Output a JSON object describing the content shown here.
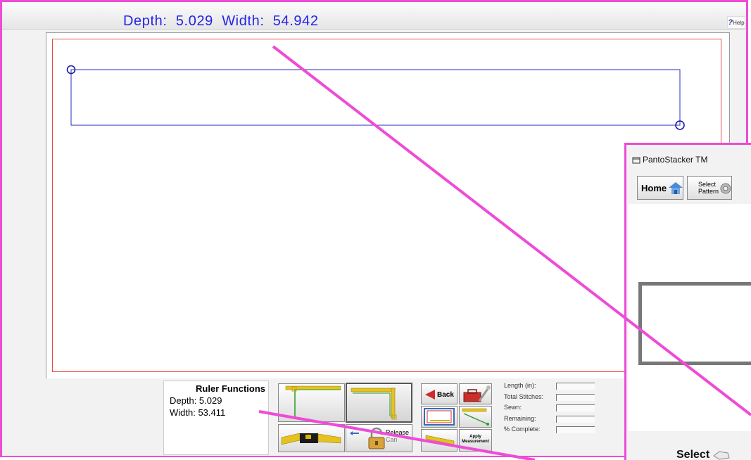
{
  "measurement_title": "Depth:  5.029  Width:  54.942",
  "help": {
    "label": "Help",
    "q": "?"
  },
  "ruler": {
    "title": "Ruler Functions",
    "depth_label": "Depth: 5.029",
    "width_label": "Width:  53.411"
  },
  "buttons": {
    "back_label": "Back",
    "release_label": "Release",
    "release_sub": "Can",
    "apply_label": "Apply",
    "apply_label2": "Measurement"
  },
  "stats": {
    "length_label": "Length (in):",
    "total_stitches_label": "Total Stitches:",
    "sewn_label": "Sewn:",
    "remaining_label": "Remaining:",
    "complete_label": "% Complete:"
  },
  "window2": {
    "title": "PantoStacker TM",
    "home_label": "Home",
    "select_pattern_line1": "Select",
    "select_pattern_line2": "Pattern",
    "select_label": "Select"
  },
  "colors": {
    "frame_accent": "#ee4bd6",
    "measurement_text": "#2324e8",
    "canvas_border": "#e84a4a",
    "ruler_line": "#2b2bc0"
  }
}
